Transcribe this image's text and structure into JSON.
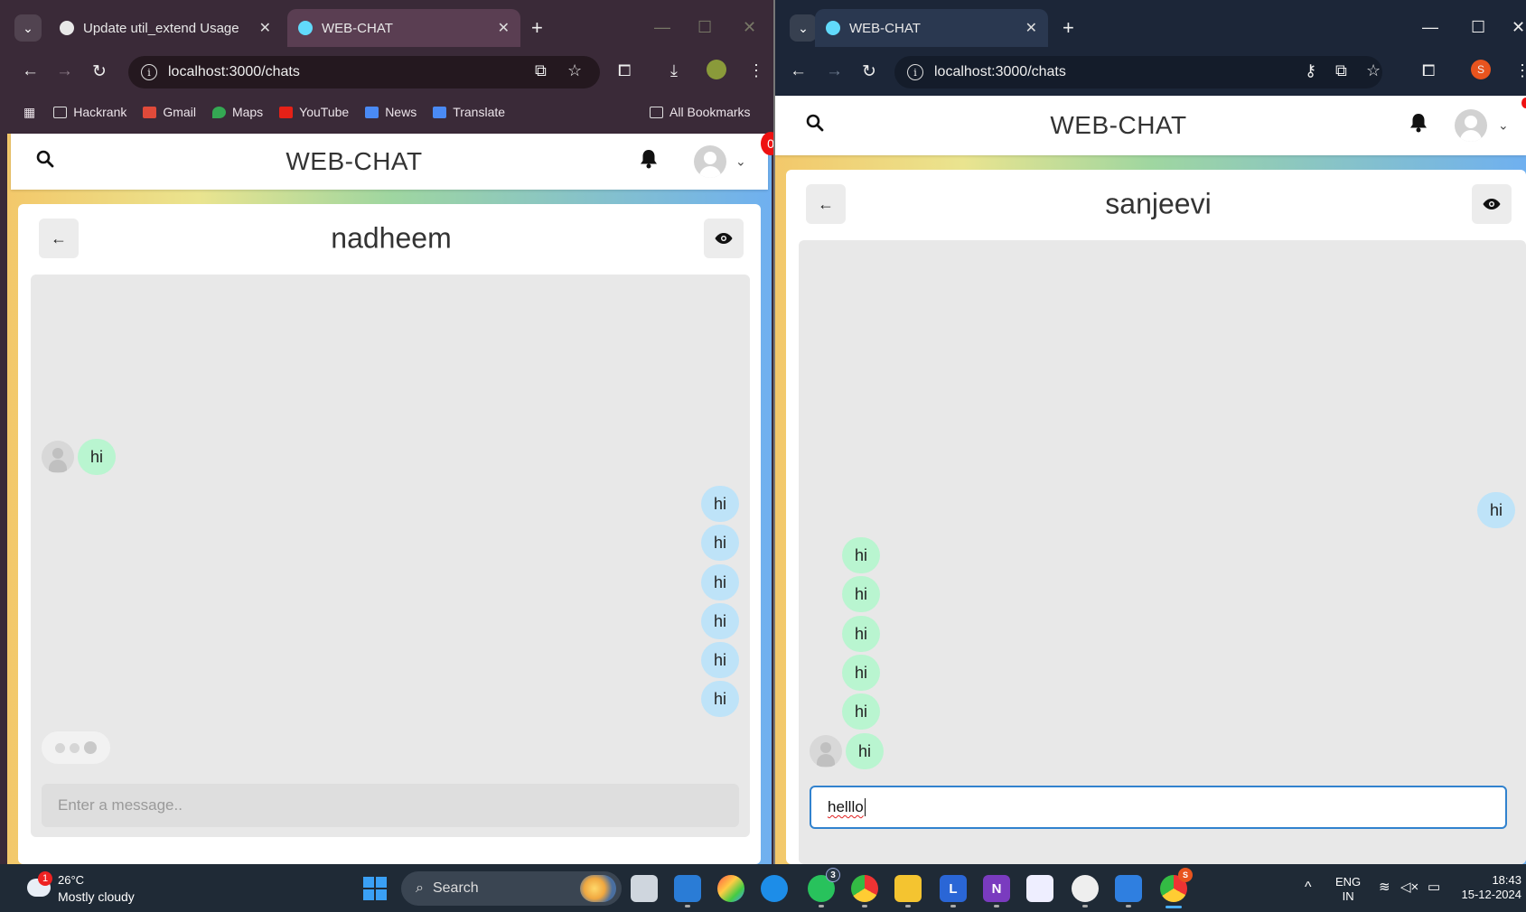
{
  "left_window": {
    "tabs": [
      {
        "title": "Update util_extend Usage"
      },
      {
        "title": "WEB-CHAT"
      }
    ],
    "url": "localhost:3000/chats",
    "bookmarks": [
      "Hackrank",
      "Gmail",
      "Maps",
      "YouTube",
      "News",
      "Translate"
    ],
    "all_bookmarks": "All Bookmarks",
    "app": {
      "title": "WEB-CHAT",
      "notification_count": "0",
      "chat_title": "nadheem",
      "messages": [
        {
          "text": "hi",
          "side": "received"
        },
        {
          "text": "hi",
          "side": "sent"
        },
        {
          "text": "hi",
          "side": "sent"
        },
        {
          "text": "hi",
          "side": "sent"
        },
        {
          "text": "hi",
          "side": "sent"
        },
        {
          "text": "hi",
          "side": "sent"
        },
        {
          "text": "hi",
          "side": "sent"
        }
      ],
      "input_placeholder": "Enter a message.."
    }
  },
  "right_window": {
    "tabs": [
      {
        "title": "WEB-CHAT"
      }
    ],
    "url": "localhost:3000/chats",
    "profile_letter": "S",
    "app": {
      "title": "WEB-CHAT",
      "chat_title": "sanjeevi",
      "messages": [
        {
          "text": "hi",
          "side": "sent"
        },
        {
          "text": "hi",
          "side": "received"
        },
        {
          "text": "hi",
          "side": "received"
        },
        {
          "text": "hi",
          "side": "received"
        },
        {
          "text": "hi",
          "side": "received"
        },
        {
          "text": "hi",
          "side": "received"
        },
        {
          "text": "hi",
          "side": "received"
        }
      ],
      "input_value": "helllo"
    }
  },
  "taskbar": {
    "weather_temp": "26°C",
    "weather_desc": "Mostly cloudy",
    "weather_badge": "1",
    "search_label": "Search",
    "whatsapp_badge": "3",
    "chrome_badge": "S",
    "lang_primary": "ENG",
    "lang_secondary": "IN",
    "time": "18:43",
    "date": "15-12-2024"
  },
  "colors": {
    "sent_bubble": "#bee3f8",
    "received_bubble": "#b9f5d0",
    "input_focus": "#3182ce",
    "badge": "#e11111"
  }
}
